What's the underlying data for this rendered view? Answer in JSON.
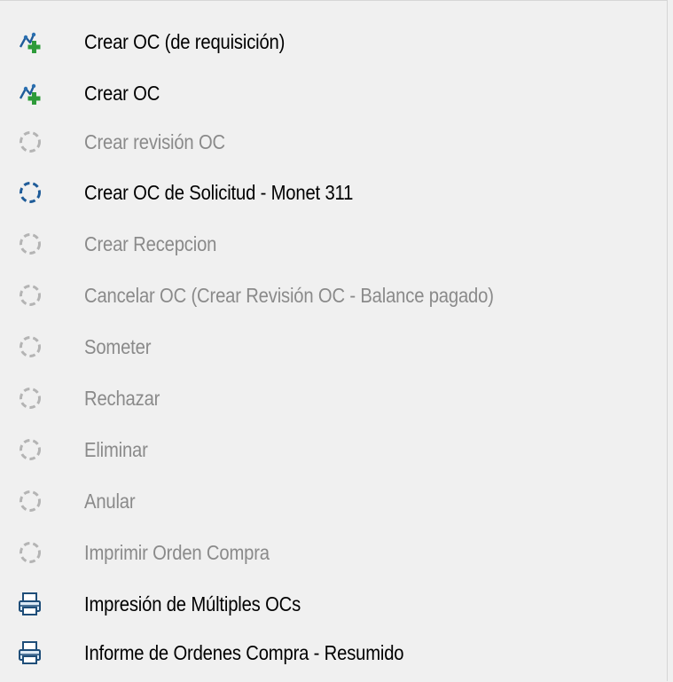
{
  "menu": {
    "items": [
      {
        "label": "Crear OC (de requisición)",
        "icon": "add-user-icon",
        "enabled": true
      },
      {
        "label": "Crear OC",
        "icon": "add-user-icon",
        "enabled": true
      },
      {
        "label": "Crear revisión OC",
        "icon": "dashed-circle-icon",
        "enabled": false
      },
      {
        "label": "Crear OC de Solicitud - Monet 311",
        "icon": "dashed-circle-icon",
        "enabled": true
      },
      {
        "label": "Crear Recepcion",
        "icon": "dashed-circle-icon",
        "enabled": false
      },
      {
        "label": "Cancelar OC (Crear Revisión OC - Balance pagado)",
        "icon": "dashed-circle-icon",
        "enabled": false
      },
      {
        "label": "Someter",
        "icon": "dashed-circle-icon",
        "enabled": false
      },
      {
        "label": "Rechazar",
        "icon": "dashed-circle-icon",
        "enabled": false
      },
      {
        "label": "Eliminar",
        "icon": "dashed-circle-icon",
        "enabled": false
      },
      {
        "label": "Anular",
        "icon": "dashed-circle-icon",
        "enabled": false
      },
      {
        "label": "Imprimir Orden Compra",
        "icon": "dashed-circle-icon",
        "enabled": false
      },
      {
        "label": "Impresión de Múltiples OCs",
        "icon": "printer-icon",
        "enabled": true
      },
      {
        "label": "Informe de Ordenes Compra - Resumido",
        "icon": "printer-icon",
        "enabled": true
      }
    ]
  },
  "colors": {
    "background": "#f0f0f0",
    "enabled_text": "#000000",
    "disabled_text": "#8a8a8a",
    "active_icon": "#1f5c99",
    "inactive_icon": "#b4b4b4"
  }
}
